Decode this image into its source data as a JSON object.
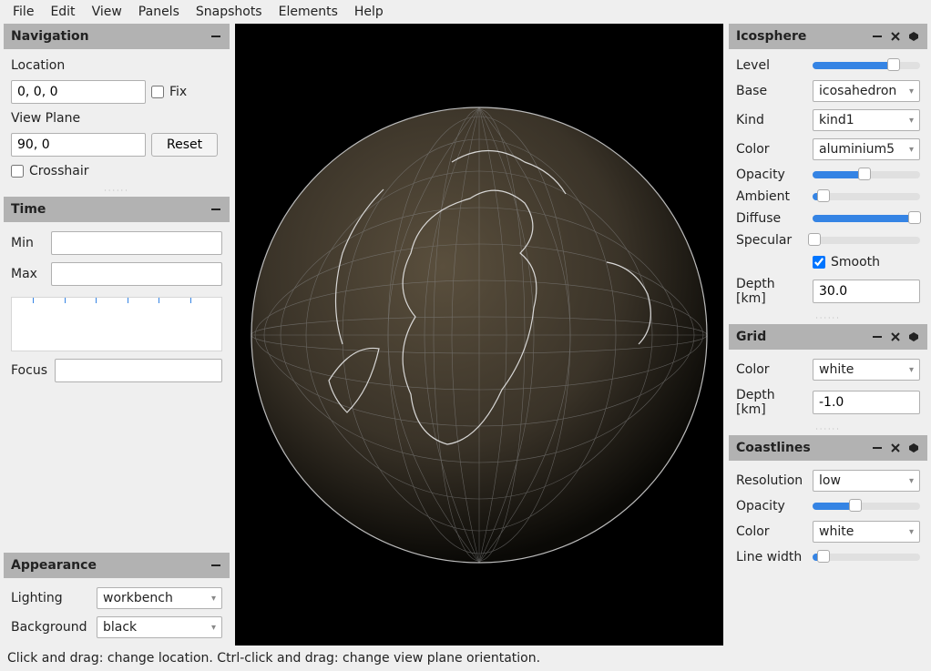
{
  "menu": [
    "File",
    "Edit",
    "View",
    "Panels",
    "Snapshots",
    "Elements",
    "Help"
  ],
  "nav": {
    "title": "Navigation",
    "location_label": "Location",
    "location_value": "0, 0, 0",
    "fix_label": "Fix",
    "viewplane_label": "View Plane",
    "viewplane_value": "90, 0",
    "reset_label": "Reset",
    "crosshair_label": "Crosshair"
  },
  "time": {
    "title": "Time",
    "min_label": "Min",
    "min_value": "",
    "max_label": "Max",
    "max_value": "",
    "focus_label": "Focus",
    "focus_value": ""
  },
  "appearance": {
    "title": "Appearance",
    "lighting_label": "Lighting",
    "lighting_value": "workbench",
    "background_label": "Background",
    "background_value": "black"
  },
  "ico": {
    "title": "Icosphere",
    "level_label": "Level",
    "level_pct": 75,
    "base_label": "Base",
    "base_value": "icosahedron",
    "kind_label": "Kind",
    "kind_value": "kind1",
    "color_label": "Color",
    "color_value": "aluminium5",
    "opacity_label": "Opacity",
    "opacity_pct": 48,
    "ambient_label": "Ambient",
    "ambient_pct": 10,
    "diffuse_label": "Diffuse",
    "diffuse_pct": 95,
    "specular_label": "Specular",
    "specular_pct": 2,
    "smooth_label": "Smooth",
    "depth_label": "Depth [km]",
    "depth_value": "30.0"
  },
  "grid": {
    "title": "Grid",
    "color_label": "Color",
    "color_value": "white",
    "depth_label": "Depth [km]",
    "depth_value": "-1.0"
  },
  "coast": {
    "title": "Coastlines",
    "resolution_label": "Resolution",
    "resolution_value": "low",
    "opacity_label": "Opacity",
    "opacity_pct": 40,
    "color_label": "Color",
    "color_value": "white",
    "linewidth_label": "Line width",
    "linewidth_pct": 10
  },
  "status": "Click and drag: change location. Ctrl-click and drag: change view plane orientation."
}
